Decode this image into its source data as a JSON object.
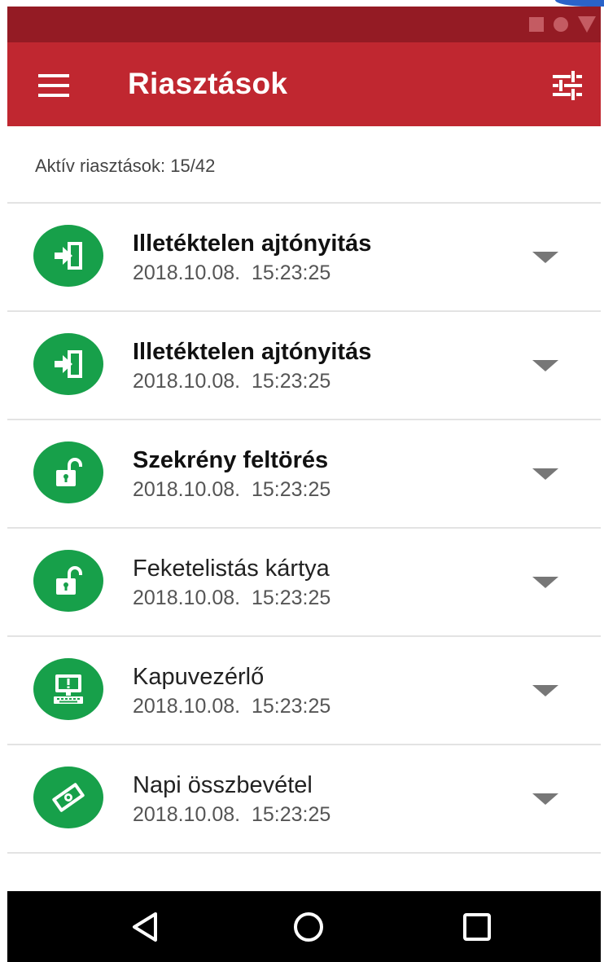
{
  "app": {
    "title": "Riasztások",
    "accent_color": "#c02730",
    "status_bar_color": "#941b24",
    "icon_bg_color": "#17a04a"
  },
  "header": {
    "menu_icon": "hamburger-menu-icon",
    "filter_icon": "tune-sliders-icon"
  },
  "summary": {
    "text": "Aktív riasztások: 15/42"
  },
  "alerts": [
    {
      "title": "Illetéktelen ajtónyitás",
      "time": "2018.10.08.  15:23:25",
      "icon": "door-enter-icon",
      "bold": true
    },
    {
      "title": "Illetéktelen ajtónyitás",
      "time": "2018.10.08.  15:23:25",
      "icon": "door-enter-icon",
      "bold": true
    },
    {
      "title": "Szekrény feltörés",
      "time": "2018.10.08.  15:23:25",
      "icon": "unlocked-padlock-icon",
      "bold": true
    },
    {
      "title": "Feketelistás kártya",
      "time": "2018.10.08.  15:23:25",
      "icon": "unlocked-padlock-icon",
      "bold": false
    },
    {
      "title": "Kapuvezérlő",
      "time": "2018.10.08.  15:23:25",
      "icon": "computer-alert-icon",
      "bold": false
    },
    {
      "title": "Napi összbevétel",
      "time": "2018.10.08.  15:23:25",
      "icon": "money-icon",
      "bold": false
    }
  ],
  "navigation": {
    "back_icon": "back-triangle-icon",
    "home_icon": "home-circle-icon",
    "recent_icon": "recent-apps-square-icon"
  }
}
